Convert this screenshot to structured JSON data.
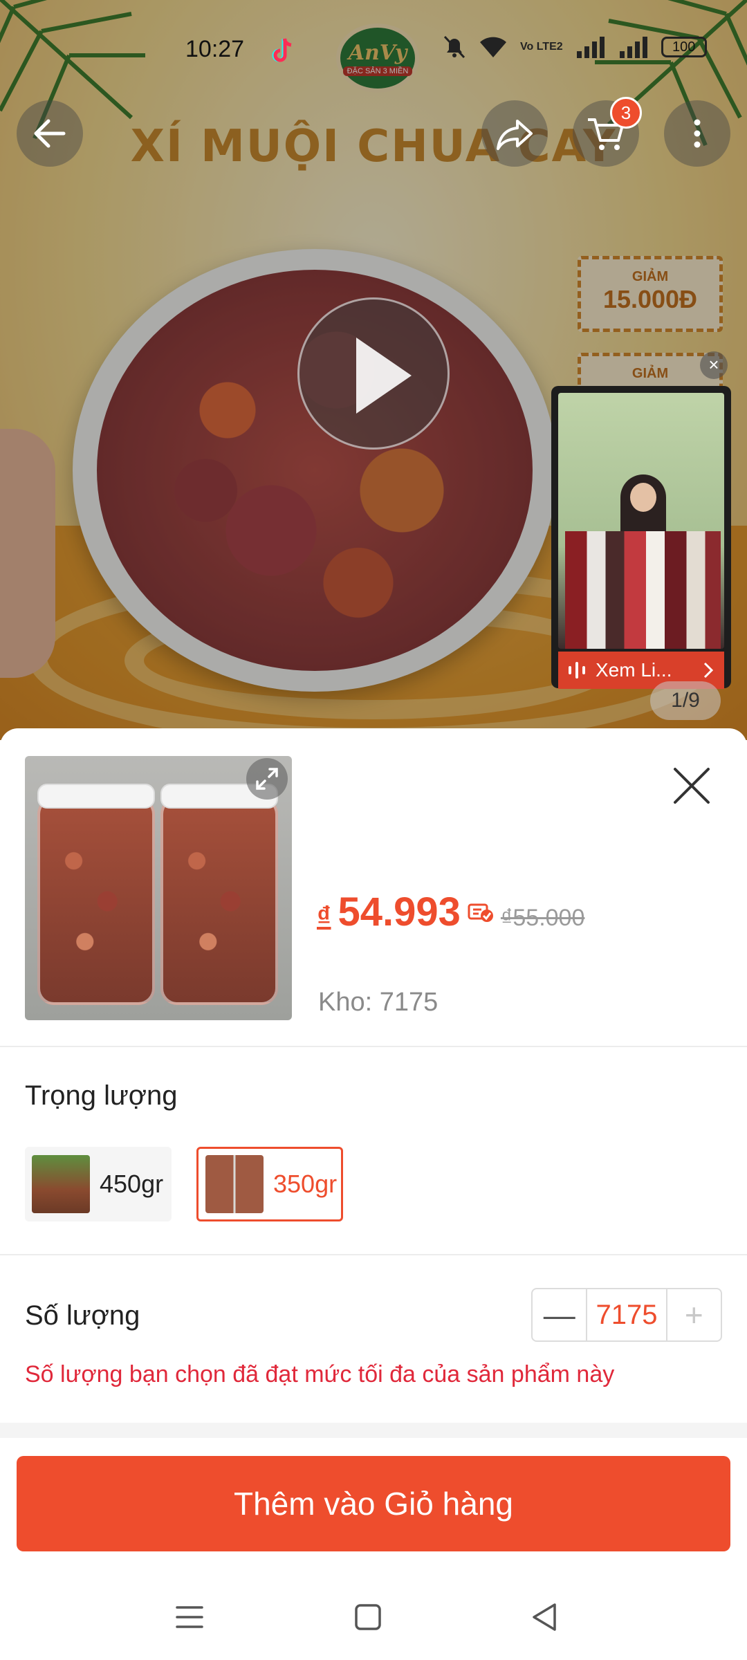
{
  "status_bar": {
    "time": "10:27",
    "battery": "100",
    "network": "Vo LTE2"
  },
  "banner": {
    "title": "XÍ MUỘI CHUA CAY",
    "logo_text": "AnVy",
    "logo_sub": "ĐẶC SẢN 3 MIỀN"
  },
  "coupons": [
    {
      "label": "GIẢM",
      "value": "15.000Đ"
    },
    {
      "label": "GIẢM",
      "value": ""
    }
  ],
  "cart": {
    "badge": "3"
  },
  "live": {
    "label": "Xem Li..."
  },
  "gallery": {
    "counter": "1/9"
  },
  "product": {
    "currency": "₫",
    "price": "54.993",
    "old_price": "₫55.000",
    "stock": "Kho: 7175"
  },
  "weight": {
    "label": "Trọng lượng",
    "options": [
      {
        "label": "450gr",
        "selected": false
      },
      {
        "label": "350gr",
        "selected": true
      }
    ]
  },
  "quantity": {
    "label": "Số lượng",
    "value": "7175",
    "minus": "—",
    "plus": "+",
    "limit_message": "Số lượng bạn chọn đã đạt mức tối đa của sản phẩm này"
  },
  "actions": {
    "add_to_cart": "Thêm vào Giỏ hàng"
  },
  "colors": {
    "accent": "#ee4d2d",
    "error": "#e0283a"
  }
}
